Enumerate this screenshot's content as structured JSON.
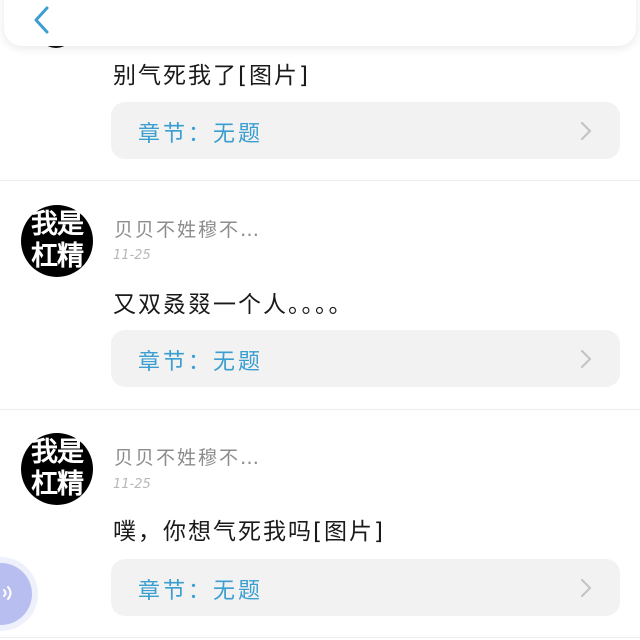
{
  "header": {
    "back_icon": "chevron-left-icon"
  },
  "comments": [
    {
      "author": "",
      "date": "",
      "text": "别气死我了[图片]",
      "chapter": "章节：无题"
    },
    {
      "author": "贝贝不姓穆不…",
      "date": "11-25",
      "avatar_text": [
        "我是",
        "杠精"
      ],
      "text": "又双叒叕一个人。。。。",
      "chapter": "章节：无题"
    },
    {
      "author": "贝贝不姓穆不…",
      "date": "11-25",
      "avatar_text": [
        "我是",
        "杠精"
      ],
      "text": "噗，你想气死我吗[图片]",
      "chapter": "章节：无题"
    }
  ],
  "float_button": {
    "icon": "sound-wave-icon"
  },
  "colors": {
    "accent": "#3a9ed1",
    "card_bg": "#f2f2f2",
    "float_bg": "#b8bff0"
  }
}
